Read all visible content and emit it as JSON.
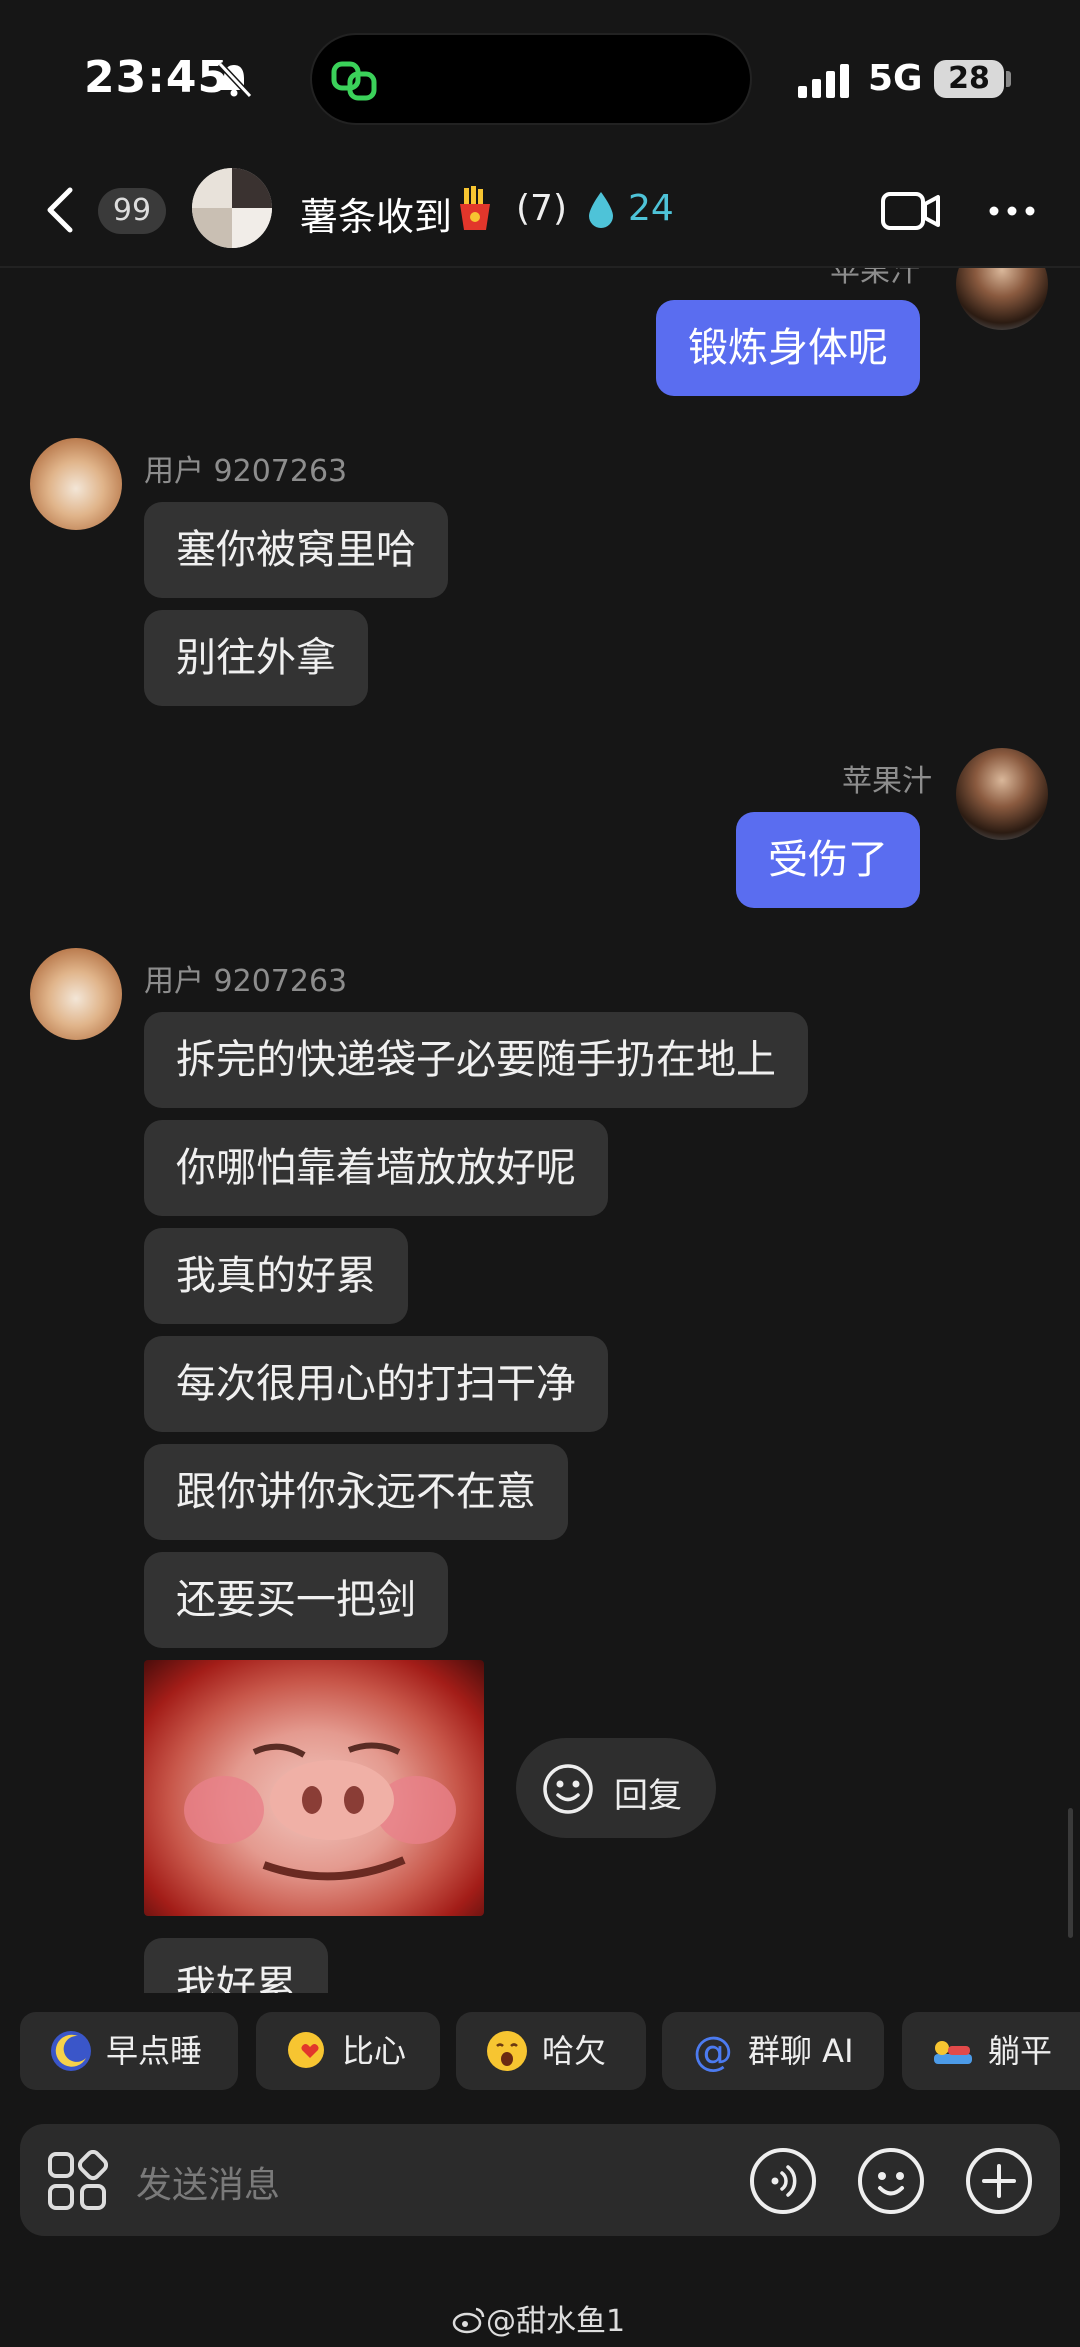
{
  "status_bar": {
    "time": "23:45",
    "network": "5G",
    "battery": "28"
  },
  "header": {
    "unread_count": "99",
    "group_name": "薯条收到",
    "member_count": "(7)",
    "fire_count": "24"
  },
  "chat": {
    "top_partial": {
      "sender": "苹果汁",
      "text": "锻炼身体呢"
    },
    "group1": {
      "sender": "用户 9207263",
      "messages": [
        "塞你被窝里哈",
        "别往外拿"
      ]
    },
    "group2": {
      "sender": "苹果汁",
      "messages": [
        "受伤了"
      ]
    },
    "group3": {
      "sender": "用户 9207263",
      "messages": [
        "拆完的快递袋子必要随手扔在地上",
        "你哪怕靠着墙放放好呢",
        "我真的好累",
        "每次很用心的打扫干净",
        "跟你讲你永远不在意",
        "还要买一把剑"
      ],
      "last_message": "我好累"
    },
    "reply_label": "回复"
  },
  "quick_chips": [
    "早点睡",
    "比心",
    "哈欠",
    "群聊 AI",
    "躺平"
  ],
  "input": {
    "placeholder": "发送消息"
  },
  "watermark": "@甜水鱼1",
  "colors": {
    "background": "#161616",
    "bubble_in": "#333333",
    "bubble_out": "#5a6df0",
    "accent_fire": "#4ec3d8"
  }
}
